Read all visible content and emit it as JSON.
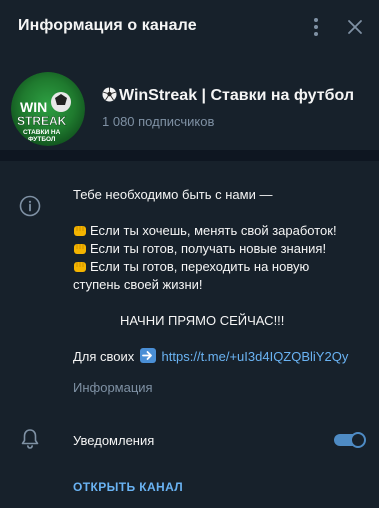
{
  "header": {
    "title": "Информация о канале"
  },
  "channel": {
    "name": "WinStreak | Ставки на футбол",
    "subscribers": "1 080 подписчиков",
    "avatar_text": {
      "line1": "WIN",
      "line2": "STREAK",
      "line3": "СТАВКИ НА",
      "line4": "ФУТБОЛ"
    }
  },
  "description": {
    "line1": "Тебе необходимо быть с нами —",
    "line2": "Если ты хочешь, менять свой заработок!",
    "line3": "Если ты готов, получать новые знания!",
    "line4": "Если ты готов, переходить на новую",
    "line5": "ступень своей жизни!",
    "line6": "НАЧНИ ПРЯМО СЕЙЧАС!!!",
    "link_prefix": "Для своих",
    "link": "https://t.me/+uI3d4IQZQBliY2Qy"
  },
  "info_label": "Информация",
  "notifications": {
    "label": "Уведомления",
    "enabled": true
  },
  "open_channel_label": "ОТКРЫТЬ КАНАЛ",
  "icons": {
    "menu": "more-vertical-icon",
    "close": "close-icon",
    "info": "info-icon",
    "bell": "bell-icon",
    "ball": "soccer-ball-icon",
    "fist": "fist-emoji-icon",
    "arrow": "arrow-right-icon"
  },
  "colors": {
    "background": "#17212b",
    "divider": "#0e1621",
    "accent": "#6ab3f3",
    "muted": "#7f91a4",
    "toggle": "#4e8bc4",
    "avatar_green": "#1f7a2e"
  }
}
